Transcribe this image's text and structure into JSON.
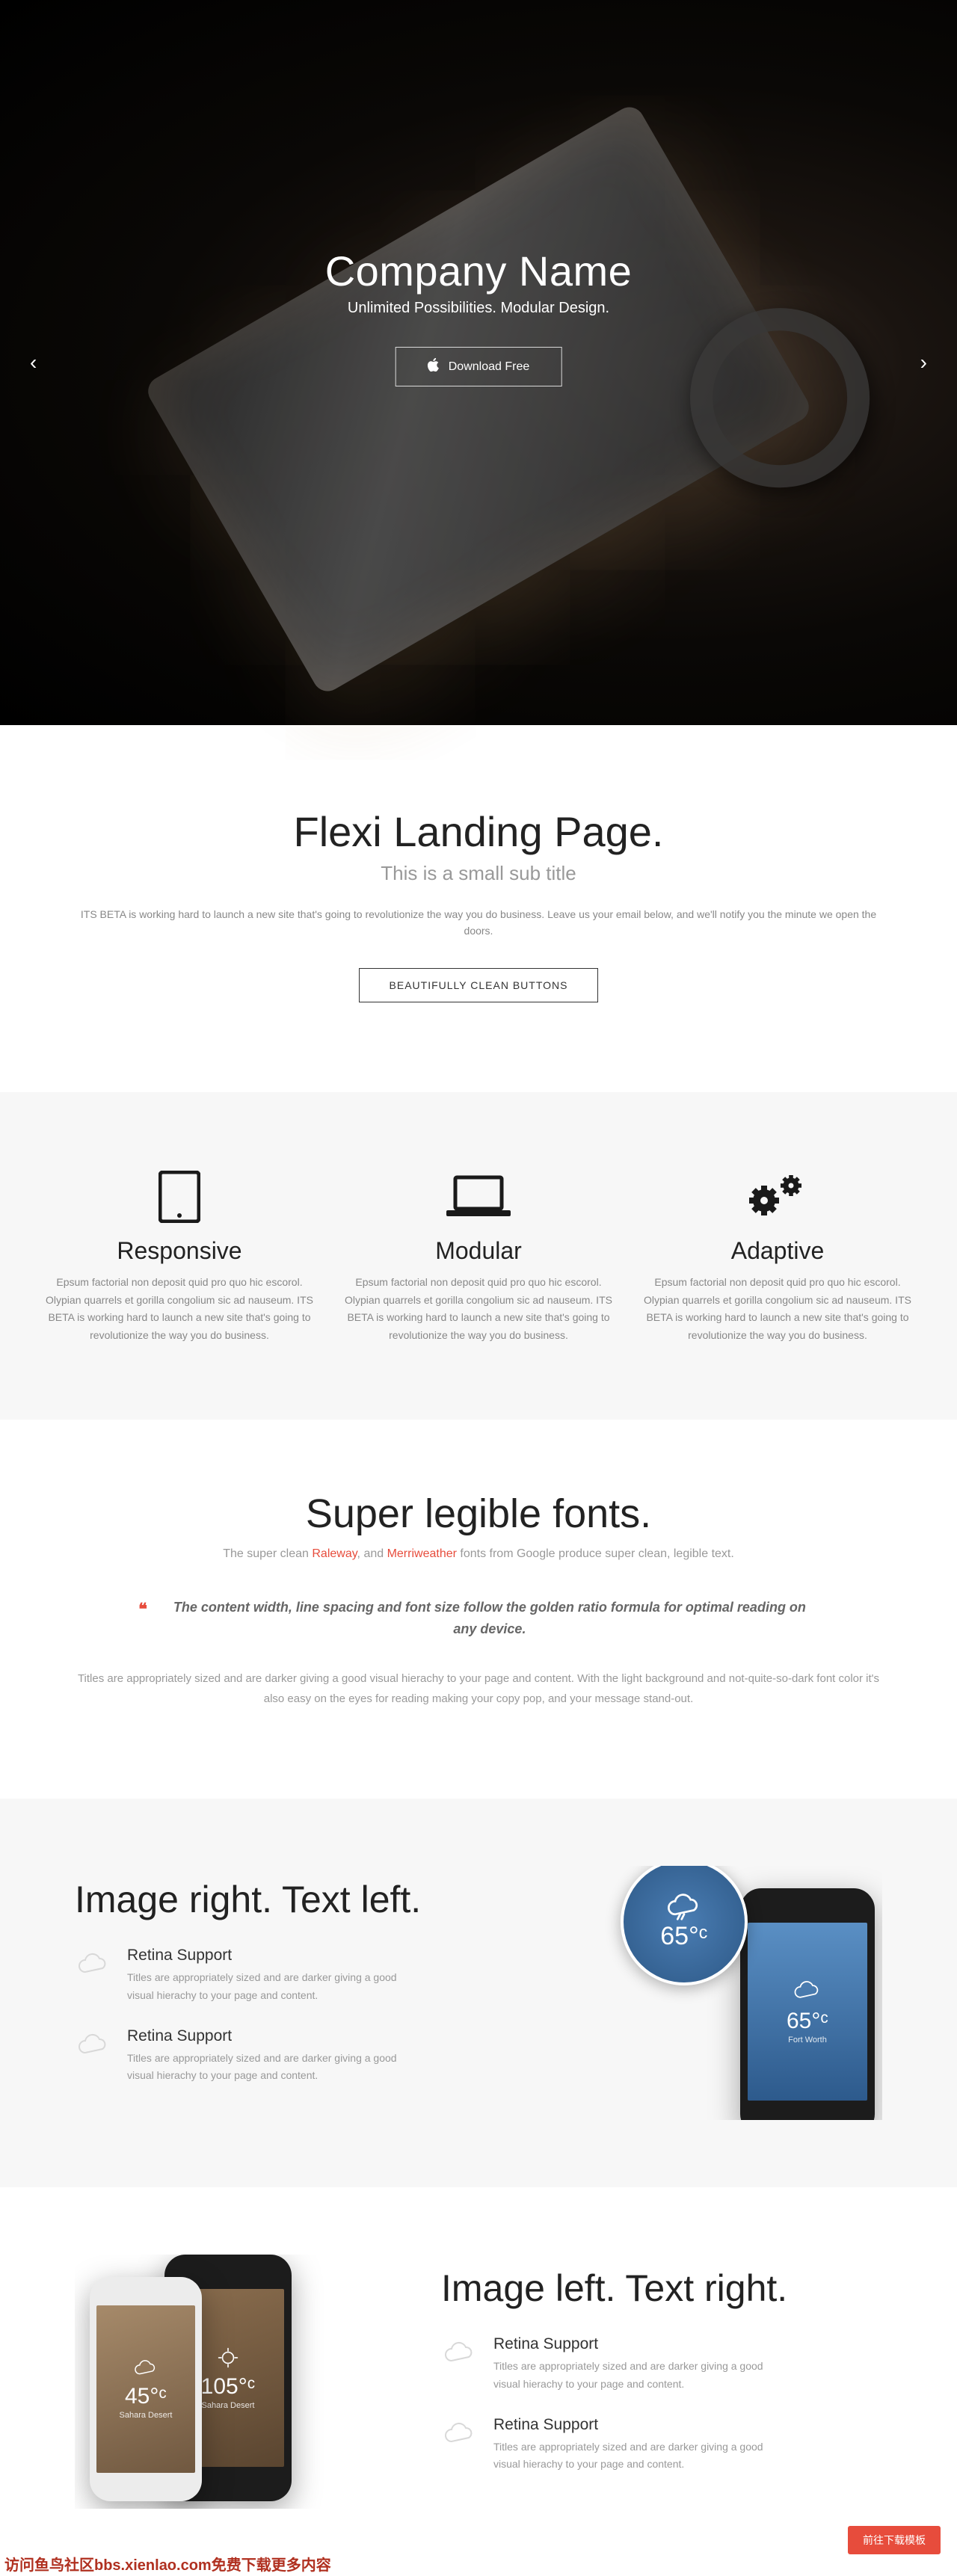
{
  "hero": {
    "title": "Company Name",
    "subtitle": "Unlimited Possibilities. Modular Design.",
    "cta": "Download Free"
  },
  "intro": {
    "title": "Flexi Landing Page.",
    "subtitle": "This is a small sub title",
    "description": "ITS BETA is working hard to launch a new site that's going to revolutionize the way you do business. Leave us your email below, and we'll notify you the minute we open the doors.",
    "button": "BEAUTIFULLY CLEAN BUTTONS"
  },
  "features": [
    {
      "icon": "tablet",
      "title": "Responsive",
      "text": "Epsum factorial non deposit quid pro quo hic escorol. Olypian quarrels et gorilla congolium sic ad nauseum. ITS BETA is working hard to launch a new site that's going to revolutionize the way you do business."
    },
    {
      "icon": "laptop",
      "title": "Modular",
      "text": "Epsum factorial non deposit quid pro quo hic escorol. Olypian quarrels et gorilla congolium sic ad nauseum. ITS BETA is working hard to launch a new site that's going to revolutionize the way you do business."
    },
    {
      "icon": "gears",
      "title": "Adaptive",
      "text": "Epsum factorial non deposit quid pro quo hic escorol. Olypian quarrels et gorilla congolium sic ad nauseum. ITS BETA is working hard to launch a new site that's going to revolutionize the way you do business."
    }
  ],
  "fonts": {
    "title": "Super legible fonts.",
    "lead_pre": "The super clean ",
    "lead_link1": "Raleway",
    "lead_mid": ", and ",
    "lead_link2": "Merriweather",
    "lead_post": " fonts from Google produce super clean, legible text.",
    "quote": "The content width, line spacing and font size follow the golden ratio formula for optimal reading on any device.",
    "body": "Titles are appropriately sized and are darker giving a good visual hierachy to your page and content. With the light background and not-quite-so-dark font color it's also easy on the eyes for reading making your copy pop, and your message stand-out."
  },
  "split1": {
    "title": "Image right. Text left.",
    "items": [
      {
        "title": "Retina Support",
        "text": "Titles are appropriately sized and are darker giving a good visual hierachy to your page and content."
      },
      {
        "title": "Retina Support",
        "text": "Titles are appropriately sized and are darker giving a good visual hierachy to your page and content."
      }
    ],
    "mockup": {
      "temp": "65°ᶜ",
      "city": "Fort Worth",
      "badge_temp": "65°ᶜ"
    }
  },
  "split2": {
    "title": "Image left. Text right.",
    "items": [
      {
        "title": "Retina Support",
        "text": "Titles are appropriately sized and are darker giving a good visual hierachy to your page and content."
      },
      {
        "title": "Retina Support",
        "text": "Titles are appropriately sized and are darker giving a good visual hierachy to your page and content."
      }
    ],
    "mockup": {
      "temp1": "45°ᶜ",
      "city1": "Sahara Desert",
      "temp2": "105°ᶜ",
      "city2": "Sahara Desert"
    }
  },
  "dl_button": "前往下载模板",
  "corner_text": "访问鱼鸟社区bbs.xienlao.com免费下载更多内容"
}
